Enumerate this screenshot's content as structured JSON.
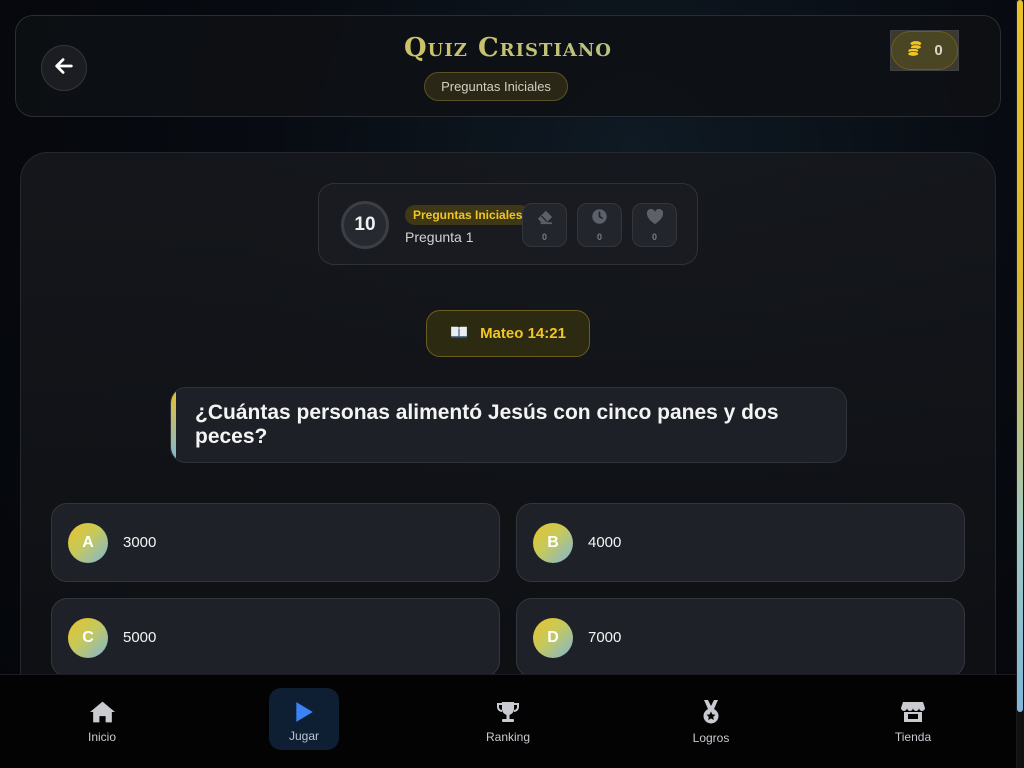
{
  "header": {
    "title": "Quiz Cristiano",
    "subtitle": "Preguntas Iniciales",
    "coins": "0"
  },
  "status": {
    "counter": "10",
    "category": "Preguntas Iniciales",
    "question_label": "Pregunta 1",
    "powerups": [
      {
        "icon": "eraser-icon",
        "count": "0"
      },
      {
        "icon": "clock-icon",
        "count": "0"
      },
      {
        "icon": "heart-icon",
        "count": "0"
      }
    ]
  },
  "verse": {
    "icon": "book-icon",
    "reference": "Mateo 14:21"
  },
  "question": {
    "text": "¿Cuántas personas alimentó Jesús con cinco panes y dos peces?"
  },
  "answers": [
    {
      "letter": "A",
      "value": "3000"
    },
    {
      "letter": "B",
      "value": "4000"
    },
    {
      "letter": "C",
      "value": "5000"
    },
    {
      "letter": "D",
      "value": "7000"
    }
  ],
  "nav": [
    {
      "label": "Inicio",
      "icon": "home-icon",
      "active": false
    },
    {
      "label": "Jugar",
      "icon": "play-icon",
      "active": true
    },
    {
      "label": "Ranking",
      "icon": "trophy-icon",
      "active": false
    },
    {
      "label": "Logros",
      "icon": "medal-icon",
      "active": false
    },
    {
      "label": "Tienda",
      "icon": "store-icon",
      "active": false
    }
  ],
  "colors": {
    "gold": "#f2c526",
    "teal": "#7fb6d8",
    "active_nav": "#0e1f33",
    "play_blue": "#3b82f6"
  }
}
